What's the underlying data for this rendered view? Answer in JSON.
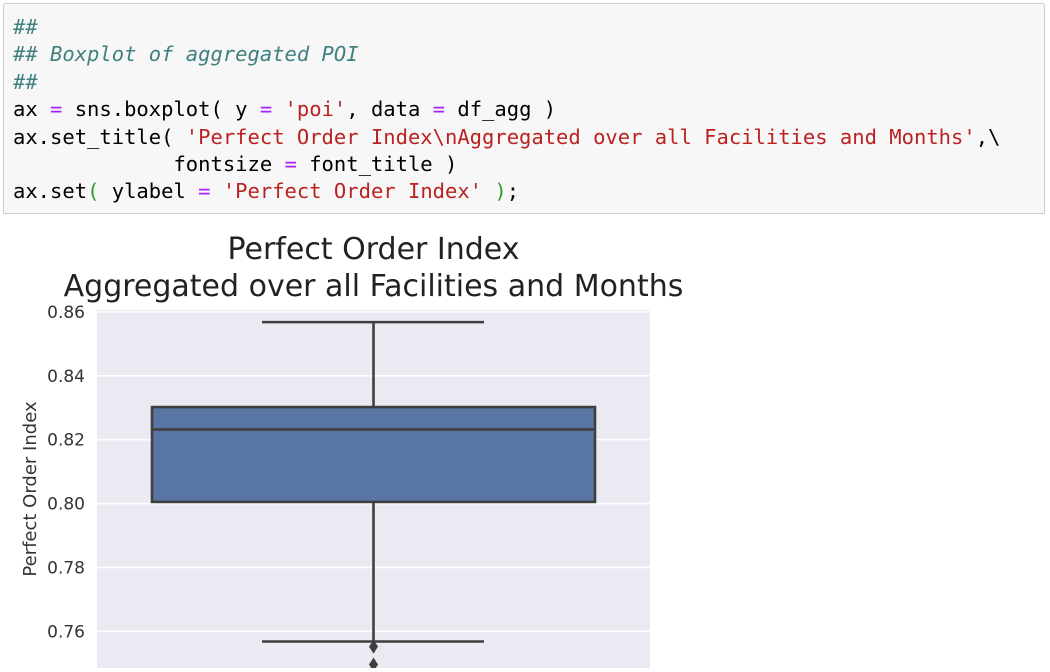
{
  "code_cell": {
    "lines": [
      [
        {
          "t": "##",
          "c": "comment"
        }
      ],
      [
        {
          "t": "## Boxplot of aggregated POI",
          "c": "comment"
        }
      ],
      [
        {
          "t": "##",
          "c": "comment"
        }
      ],
      [
        {
          "t": "ax ",
          "c": "plain"
        },
        {
          "t": "=",
          "c": "op"
        },
        {
          "t": " sns.boxplot( y ",
          "c": "plain"
        },
        {
          "t": "=",
          "c": "op"
        },
        {
          "t": " ",
          "c": "plain"
        },
        {
          "t": "'poi'",
          "c": "string"
        },
        {
          "t": ", data ",
          "c": "plain"
        },
        {
          "t": "=",
          "c": "op"
        },
        {
          "t": " df_agg )",
          "c": "plain"
        }
      ],
      [
        {
          "t": "ax.set_title( ",
          "c": "plain"
        },
        {
          "t": "'Perfect Order Index\\nAggregated over all Facilities and Months'",
          "c": "string"
        },
        {
          "t": ",\\",
          "c": "plain"
        }
      ],
      [
        {
          "t": "             fontsize ",
          "c": "plain"
        },
        {
          "t": "=",
          "c": "op"
        },
        {
          "t": " font_title )",
          "c": "plain"
        }
      ],
      [
        {
          "t": "ax.set",
          "c": "plain"
        },
        {
          "t": "(",
          "c": "greenparen"
        },
        {
          "t": " ylabel ",
          "c": "plain"
        },
        {
          "t": "=",
          "c": "op"
        },
        {
          "t": " ",
          "c": "plain"
        },
        {
          "t": "'Perfect Order Index'",
          "c": "string"
        },
        {
          "t": " ",
          "c": "plain"
        },
        {
          "t": ")",
          "c": "greenparen"
        },
        {
          "t": ";",
          "c": "plain"
        }
      ]
    ]
  },
  "colors": {
    "comment": "#408080",
    "string": "#ba2121",
    "op": "#aa22ff",
    "plain": "#000000",
    "greenparen": "#2a9d2a",
    "plot_bg": "#eaeaf2",
    "grid": "#ffffff",
    "box_fill": "#5975a4",
    "line": "#3f3f3f"
  },
  "chart_data": {
    "type": "box",
    "title": "Perfect Order Index\nAggregated over all Facilities and Months",
    "title_lines": [
      "Perfect Order Index",
      "Aggregated over all Facilities and Months"
    ],
    "ylabel": "Perfect Order Index",
    "xlabel": "",
    "ylim": [
      0.7485,
      0.8606
    ],
    "yticks": [
      0.76,
      0.78,
      0.8,
      0.82,
      0.84,
      0.86
    ],
    "ytick_labels": [
      "0.76",
      "0.78",
      "0.80",
      "0.82",
      "0.84",
      "0.86"
    ],
    "grid": true,
    "series": [
      {
        "whisker_low": 0.7568,
        "q1": 0.8005,
        "median": 0.8232,
        "q3": 0.8302,
        "whisker_high": 0.8568,
        "outliers": [
          0.7552,
          0.7496
        ]
      }
    ]
  }
}
